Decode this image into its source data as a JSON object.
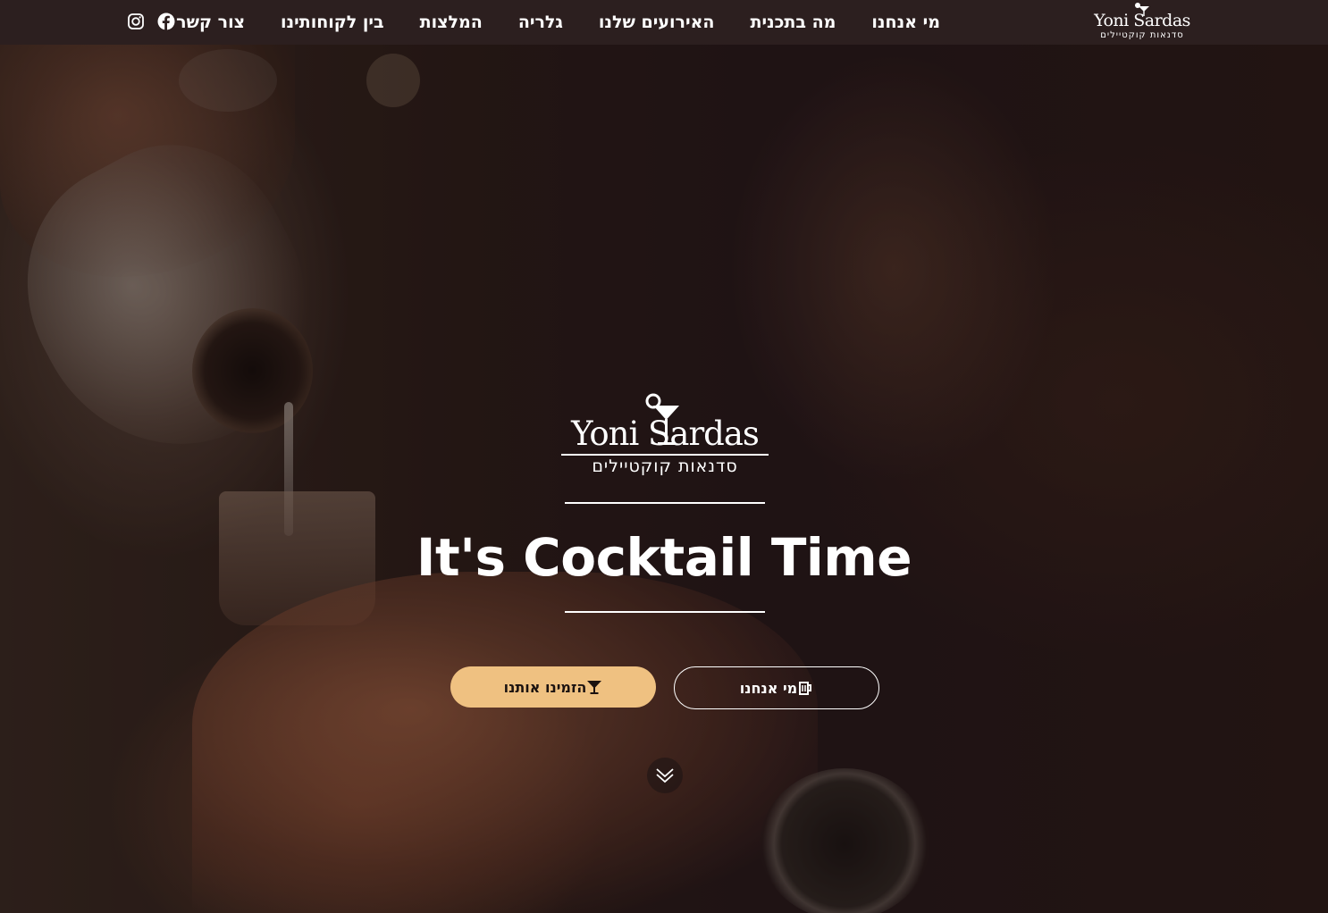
{
  "brand": {
    "name_script": "Yoni Sardas",
    "tagline": "סדנאות קוקטיילים"
  },
  "nav": {
    "items": [
      {
        "label": "מי אנחנו"
      },
      {
        "label": "מה בתכנית"
      },
      {
        "label": "האירועים שלנו"
      },
      {
        "label": "גלריה"
      },
      {
        "label": "המלצות"
      },
      {
        "label": "בין לקוחותינו"
      },
      {
        "label": "צור קשר"
      }
    ],
    "social": [
      "facebook-icon",
      "instagram-icon"
    ]
  },
  "hero": {
    "headline": "It's Cocktail Time",
    "primary_button": {
      "label": "הזמינו אותנו",
      "icon": "cocktail-glass-icon"
    },
    "secondary_button": {
      "label": "מי אנחנו",
      "icon": "beer-mug-icon"
    },
    "scroll_icon": "double-chevron-down-icon"
  },
  "colors": {
    "navbar": "#2c1f1f",
    "accent": "#efc181",
    "text": "#ffffff"
  }
}
